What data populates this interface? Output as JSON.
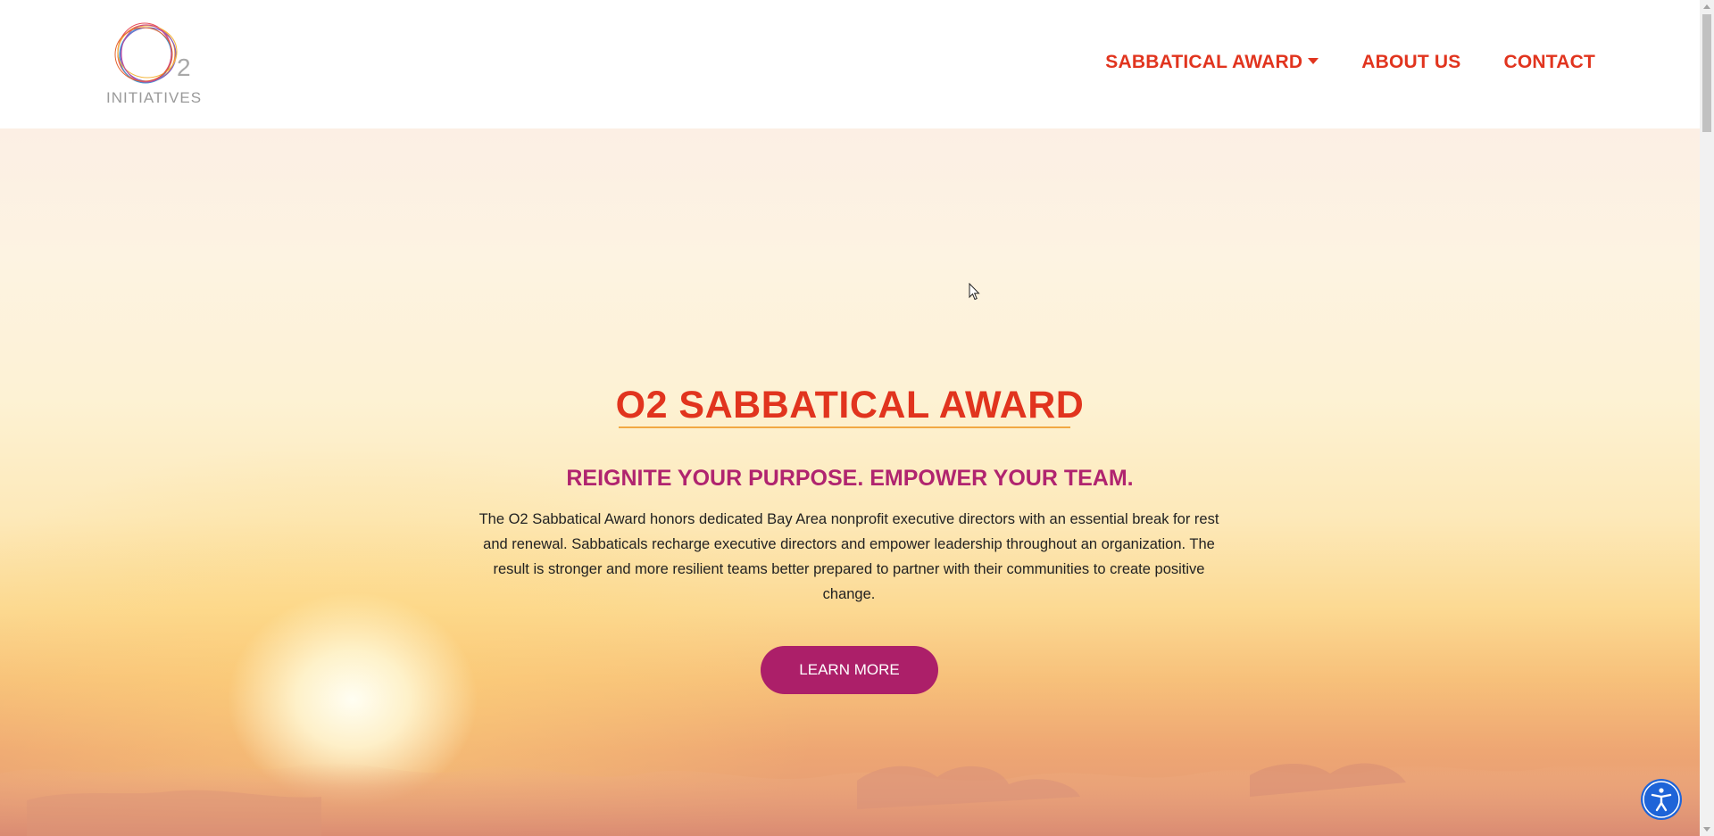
{
  "header": {
    "logo": {
      "mark_text": "2",
      "wordmark": "INITIATIVES"
    },
    "nav": {
      "items": [
        {
          "label": "SABBATICAL AWARD",
          "has_dropdown": true
        },
        {
          "label": "ABOUT US",
          "has_dropdown": false
        },
        {
          "label": "CONTACT",
          "has_dropdown": false
        }
      ]
    }
  },
  "hero": {
    "title": "O2 SABBATICAL AWARD",
    "subtitle": "REIGNITE YOUR PURPOSE. EMPOWER YOUR TEAM.",
    "body": "The O2 Sabbatical Award honors dedicated Bay Area nonprofit executive directors with an essential break for rest and renewal. Sabbaticals recharge executive directors and empower leadership throughout an organization. The result is stronger and more resilient teams better prepared to partner with their communities to create positive change.",
    "cta_label": "LEARN MORE"
  },
  "colors": {
    "brand_red": "#e1341e",
    "brand_magenta": "#b0246f",
    "button_magenta": "#ac1f69",
    "underline_gold": "#f1a843",
    "accessibility_blue": "#1e64d8"
  },
  "icons": {
    "accessibility": "accessibility-icon",
    "dropdown": "chevron-down-icon",
    "cursor": "mouse-pointer-icon"
  }
}
